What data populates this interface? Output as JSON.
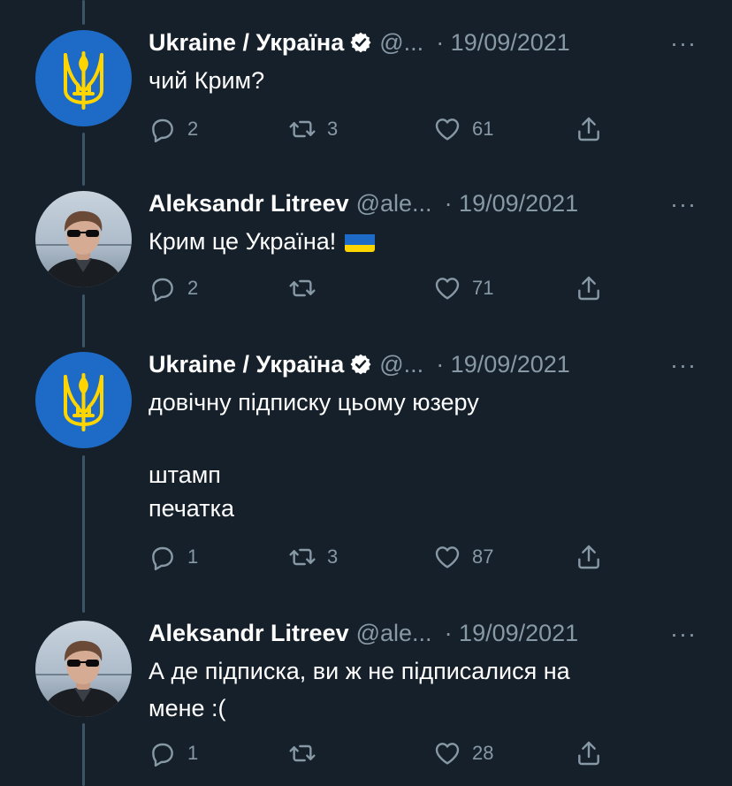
{
  "tweets": [
    {
      "author": "Ukraine / Україна",
      "handle": "@...",
      "date": "· 19/09/2021",
      "more": "···",
      "lines": [
        "чий Крим?"
      ],
      "replies": "2",
      "retweets": "3",
      "likes": "61",
      "verified": true,
      "avatar": "ukraine-trident-icon"
    },
    {
      "author": "Aleksandr Litreev",
      "handle": "@ale...",
      "date": "· 19/09/2021",
      "more": "···",
      "lines": [
        "Крим це Україна!"
      ],
      "replies": "2",
      "retweets": "",
      "likes": "71",
      "verified": false,
      "avatar": "person-photo"
    },
    {
      "author": "Ukraine / Україна",
      "handle": "@...",
      "date": "· 19/09/2021",
      "more": "···",
      "lines": [
        "довічну підписку цьому юзеру",
        "",
        "штамп",
        "печатка"
      ],
      "replies": "1",
      "retweets": "3",
      "likes": "87",
      "verified": true,
      "avatar": "ukraine-trident-icon"
    },
    {
      "author": "Aleksandr Litreev",
      "handle": "@ale...",
      "date": "· 19/09/2021",
      "more": "···",
      "lines": [
        "А де підписка, ви ж не підписалися на",
        "мене :("
      ],
      "replies": "1",
      "retweets": "",
      "likes": "28",
      "verified": false,
      "avatar": "person-photo"
    }
  ],
  "colors": {
    "background": "#15202b",
    "muted": "#8899a6",
    "thread_line": "#3d5466",
    "ukraine_blue": "#1d6bc6",
    "ukraine_yellow": "#ffd500"
  }
}
